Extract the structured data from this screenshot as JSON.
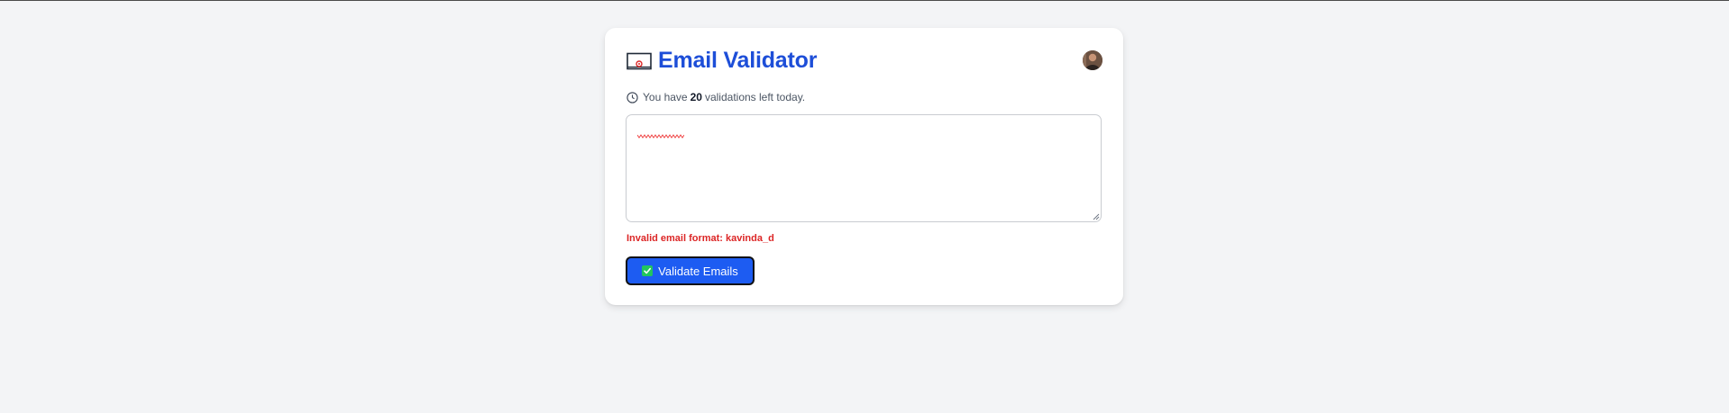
{
  "app": {
    "title": "Email Validator",
    "title_icon": "envelope-icon"
  },
  "user": {
    "avatar_icon": "user-avatar"
  },
  "quota": {
    "prefix": "You have",
    "count": "20",
    "suffix": "validations left today.",
    "icon": "clock-icon"
  },
  "input": {
    "value": "",
    "spellcheck_underline": true
  },
  "error": {
    "message": "Invalid email format: kavinda_d"
  },
  "actions": {
    "validate_label": "Validate Emails",
    "validate_icon": "check-icon"
  },
  "colors": {
    "title": "#1d4ed8",
    "button": "#1d5cf2",
    "error": "#dc2626",
    "background": "#f3f4f6"
  }
}
